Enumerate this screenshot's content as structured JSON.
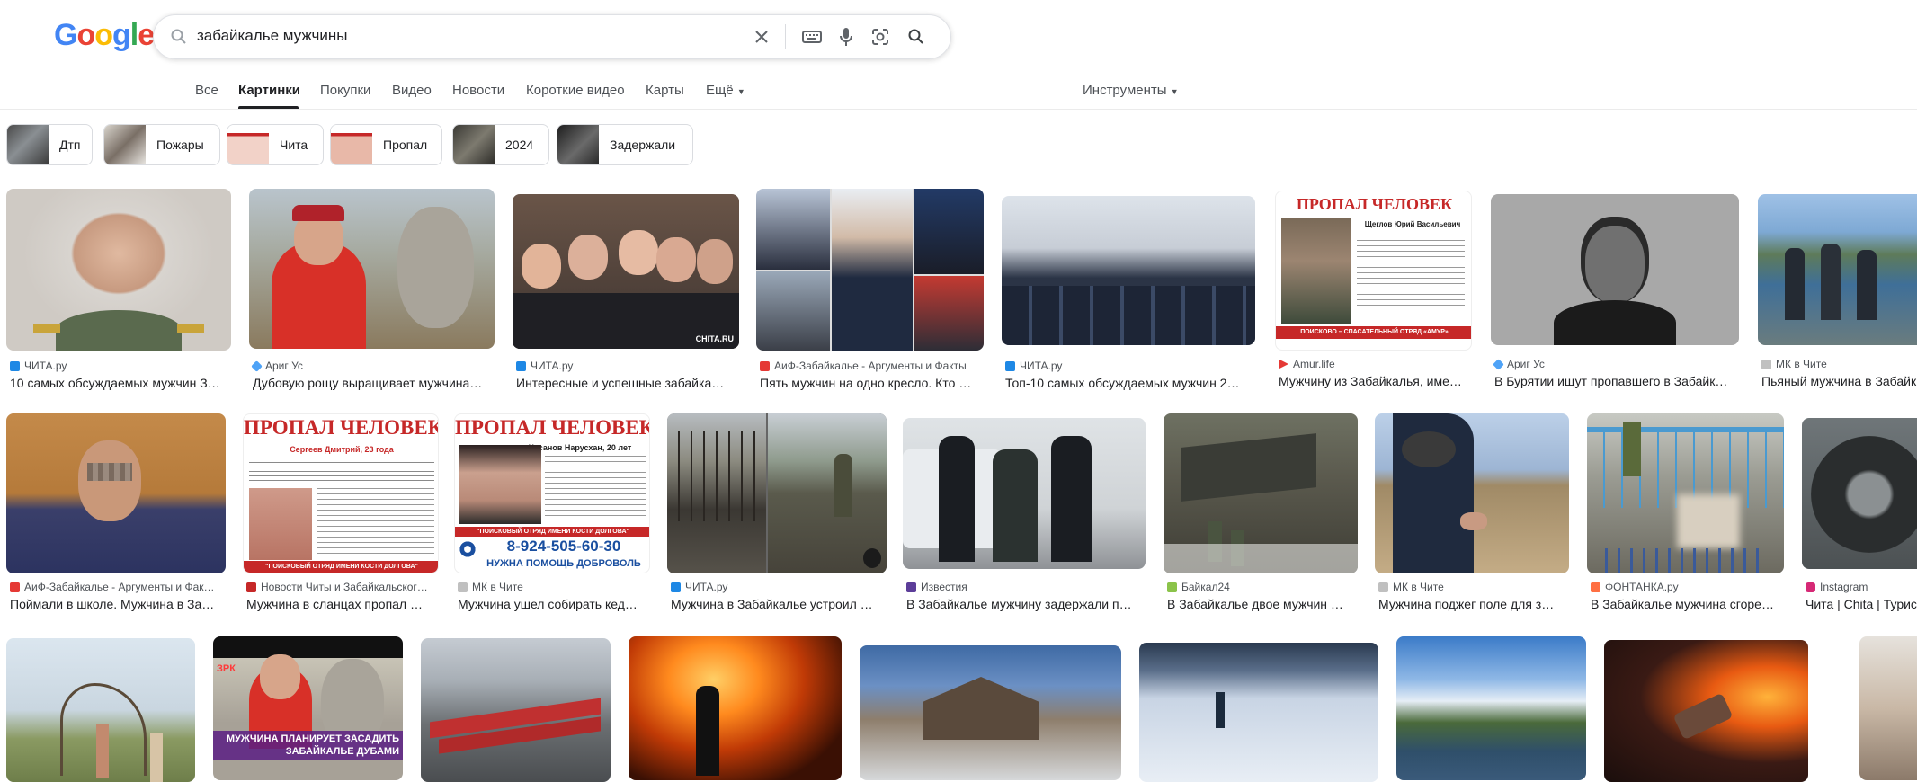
{
  "logo": {
    "text": "Google",
    "colors": [
      "#4285F4",
      "#EA4335",
      "#FBBC05",
      "#4285F4",
      "#34A853",
      "#EA4335"
    ]
  },
  "search": {
    "query": "забайкалье мужчины"
  },
  "tabs": [
    "Все",
    "Картинки",
    "Покупки",
    "Видео",
    "Новости",
    "Короткие видео",
    "Карты",
    "Ещё"
  ],
  "tools_label": "Инструменты",
  "chips": [
    "Дтп",
    "Пожары",
    "Чита",
    "Пропал",
    "2024",
    "Задержали"
  ],
  "results": {
    "row1": [
      {
        "source": "ЧИТА.ру",
        "title": "10 самых обсуждаемых мужчин З…",
        "fav": "#1e88e5"
      },
      {
        "source": "Ариг Ус",
        "title": "Дубовую рощу выращивает мужчина…",
        "fav": "#4fa3f7"
      },
      {
        "source": "ЧИТА.ру",
        "title": "Интересные и успешные забайка…",
        "fav": "#1e88e5"
      },
      {
        "source": "АиФ-Забайкалье - Аргументы и Факты",
        "title": "Пять мужчин на одно кресло. Кто …",
        "fav": "#e53935"
      },
      {
        "source": "ЧИТА.ру",
        "title": "Топ-10 самых обсуждаемых мужчин 2…",
        "fav": "#1e88e5"
      },
      {
        "source": "Amur.life",
        "title": "Мужчину из Забайкалья, име…",
        "fav": "#e53935"
      },
      {
        "source": "Ариг Ус",
        "title": "В Бурятии ищут пропавшего в Забайк…",
        "fav": "#4fa3f7"
      },
      {
        "source": "МК в Чите",
        "title": "Пьяный мужчина в Забайк",
        "fav": "#c0c0c0"
      }
    ],
    "row2": [
      {
        "source": "АиФ-Забайкалье - Аргументы и Фак…",
        "title": "Поймали в школе. Мужчина в За…",
        "fav": "#e53935"
      },
      {
        "source": "Новости Читы и Забайкальског…",
        "title": "Мужчина в сланцах пропал …",
        "fav": "#c62828"
      },
      {
        "source": "МК в Чите",
        "title": "Мужчина ушел собирать кед…",
        "fav": "#c0c0c0"
      },
      {
        "source": "ЧИТА.ру",
        "title": "Мужчина в Забайкалье устроил …",
        "fav": "#1e88e5"
      },
      {
        "source": "Известия",
        "title": "В Забайкалье мужчину задержали п…",
        "fav": "#5c3d99"
      },
      {
        "source": "Байкал24",
        "title": "В Забайкалье двое мужчин …",
        "fav": "#8bc34a"
      },
      {
        "source": "МК в Чите",
        "title": "Мужчина поджег поле для з…",
        "fav": "#c0c0c0"
      },
      {
        "source": "ФОНТАНКА.ру",
        "title": "В Забайкалье мужчина сгоре…",
        "fav": "#ff7043"
      },
      {
        "source": "Instagram",
        "title": "Чита | Chita | Турис",
        "fav": "#d62976"
      }
    ]
  },
  "overlays": {
    "poster1_title": "ПРОПАЛ ЧЕЛОВЕК",
    "poster1_name": "Щеглов Юрий Васильевич",
    "poster1_footer": "ПОИСКОВО – СПАСАТЕЛЬНЫЙ ОТРЯД «АМУР»",
    "poster2_title": "ПРОПАЛ ЧЕЛОВЕК",
    "poster2_name": "Сергеев Дмитрий, 23 года",
    "poster2_footer": "\"ПОИСКОВЫЙ ОТРЯД ИМЕНИ КОСТИ ДОЛГОВА\"",
    "poster3_title": "ПРОПАЛ ЧЕЛОВЕК",
    "poster3_name": "Хасанов Нарусхан, 20 лет",
    "poster3_org": "\"ПОИСКОВЫЙ ОТРЯД ИМЕНИ КОСТИ ДОЛГОВА\"",
    "poster3_phone": "8-924-505-60-30",
    "poster3_help": "НУЖНА ПОМОЩЬ ДОБРОВОЛЬ",
    "chita_watermark": "CHITA.RU",
    "tree_caption": "МУЖЧИНА ПЛАНИРУЕТ ЗАСАДИТЬ ЗАБАЙКАЛЬЕ ДУБАМИ",
    "tree_logo": "ЗРК"
  }
}
